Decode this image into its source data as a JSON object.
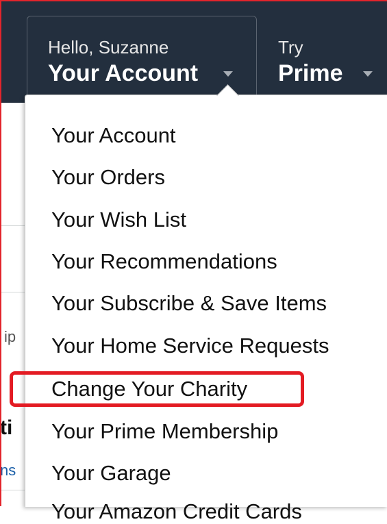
{
  "header": {
    "greeting": "Hello, Suzanne",
    "account_label": "Your Account",
    "try_label": "Try",
    "prime_label": "Prime"
  },
  "background_fragments": {
    "frag1": "ip",
    "frag2": "ti",
    "frag3": "ns"
  },
  "menu": {
    "items": [
      {
        "label": "Your Account"
      },
      {
        "label": "Your Orders"
      },
      {
        "label": "Your Wish List"
      },
      {
        "label": "Your Recommendations"
      },
      {
        "label": "Your Subscribe & Save Items"
      },
      {
        "label": "Your Home Service Requests"
      },
      {
        "label": "Change Your Charity"
      },
      {
        "label": "Your Prime Membership"
      },
      {
        "label": "Your Garage"
      },
      {
        "label": "Your Amazon Credit Cards"
      }
    ],
    "highlighted_item": "Change Your Charity"
  },
  "colors": {
    "nav_background": "#232f3e",
    "highlight_border": "#e31b23"
  }
}
